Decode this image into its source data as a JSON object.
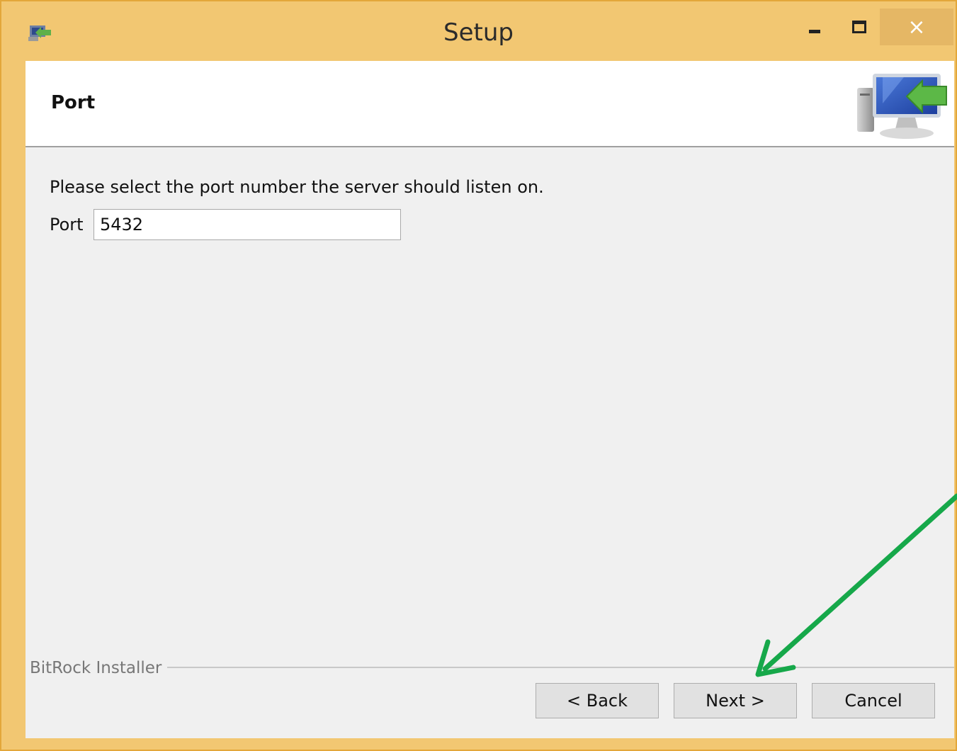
{
  "window": {
    "title": "Setup",
    "close_glyph": "×"
  },
  "header": {
    "title": "Port",
    "icon": "installer-computer-icon"
  },
  "main": {
    "instruction": "Please select the port number the server should listen on.",
    "port_label": "Port",
    "port_value": "5432"
  },
  "footer": {
    "vendor": "BitRock Installer",
    "back_label": "< Back",
    "next_label": "Next >",
    "cancel_label": "Cancel"
  },
  "annotation": {
    "type": "arrow",
    "color": "#16a84a",
    "points_to": "next-button"
  },
  "colors": {
    "titlebar": "#f2c772",
    "client_bg": "#f0f0f0",
    "arrow": "#16a84a"
  }
}
